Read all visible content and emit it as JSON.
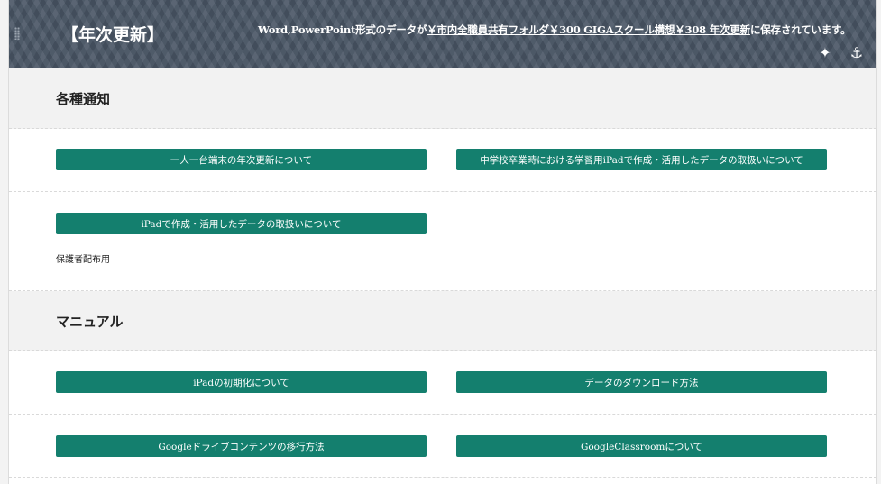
{
  "header": {
    "title": "【年次更新】",
    "note_prefix": "Word,PowerPoint形式のデータが",
    "note_path": "￥市内全職員共有フォルダ￥300 GIGAスクール構想￥308 年次更新",
    "note_suffix": "に保存されています。",
    "icons": [
      "sparkle-icon",
      "anchor-icon"
    ]
  },
  "sections": [
    {
      "heading": "各種通知",
      "rows": [
        {
          "buttons": [
            {
              "label": "一人一台端末の年次更新について"
            },
            {
              "label": "中学校卒業時における学習用iPadで作成・活用したデータの取扱いについて"
            }
          ]
        },
        {
          "buttons": [
            {
              "label": "iPadで作成・活用したデータの取扱いについて"
            }
          ],
          "note": "保護者配布用"
        }
      ]
    },
    {
      "heading": "マニュアル",
      "rows": [
        {
          "buttons": [
            {
              "label": "iPadの初期化について"
            },
            {
              "label": "データのダウンロード方法"
            }
          ]
        },
        {
          "buttons": [
            {
              "label": "Googleドライブコンテンツの移行方法"
            },
            {
              "label": "GoogleClassroomについて"
            }
          ]
        }
      ]
    }
  ]
}
